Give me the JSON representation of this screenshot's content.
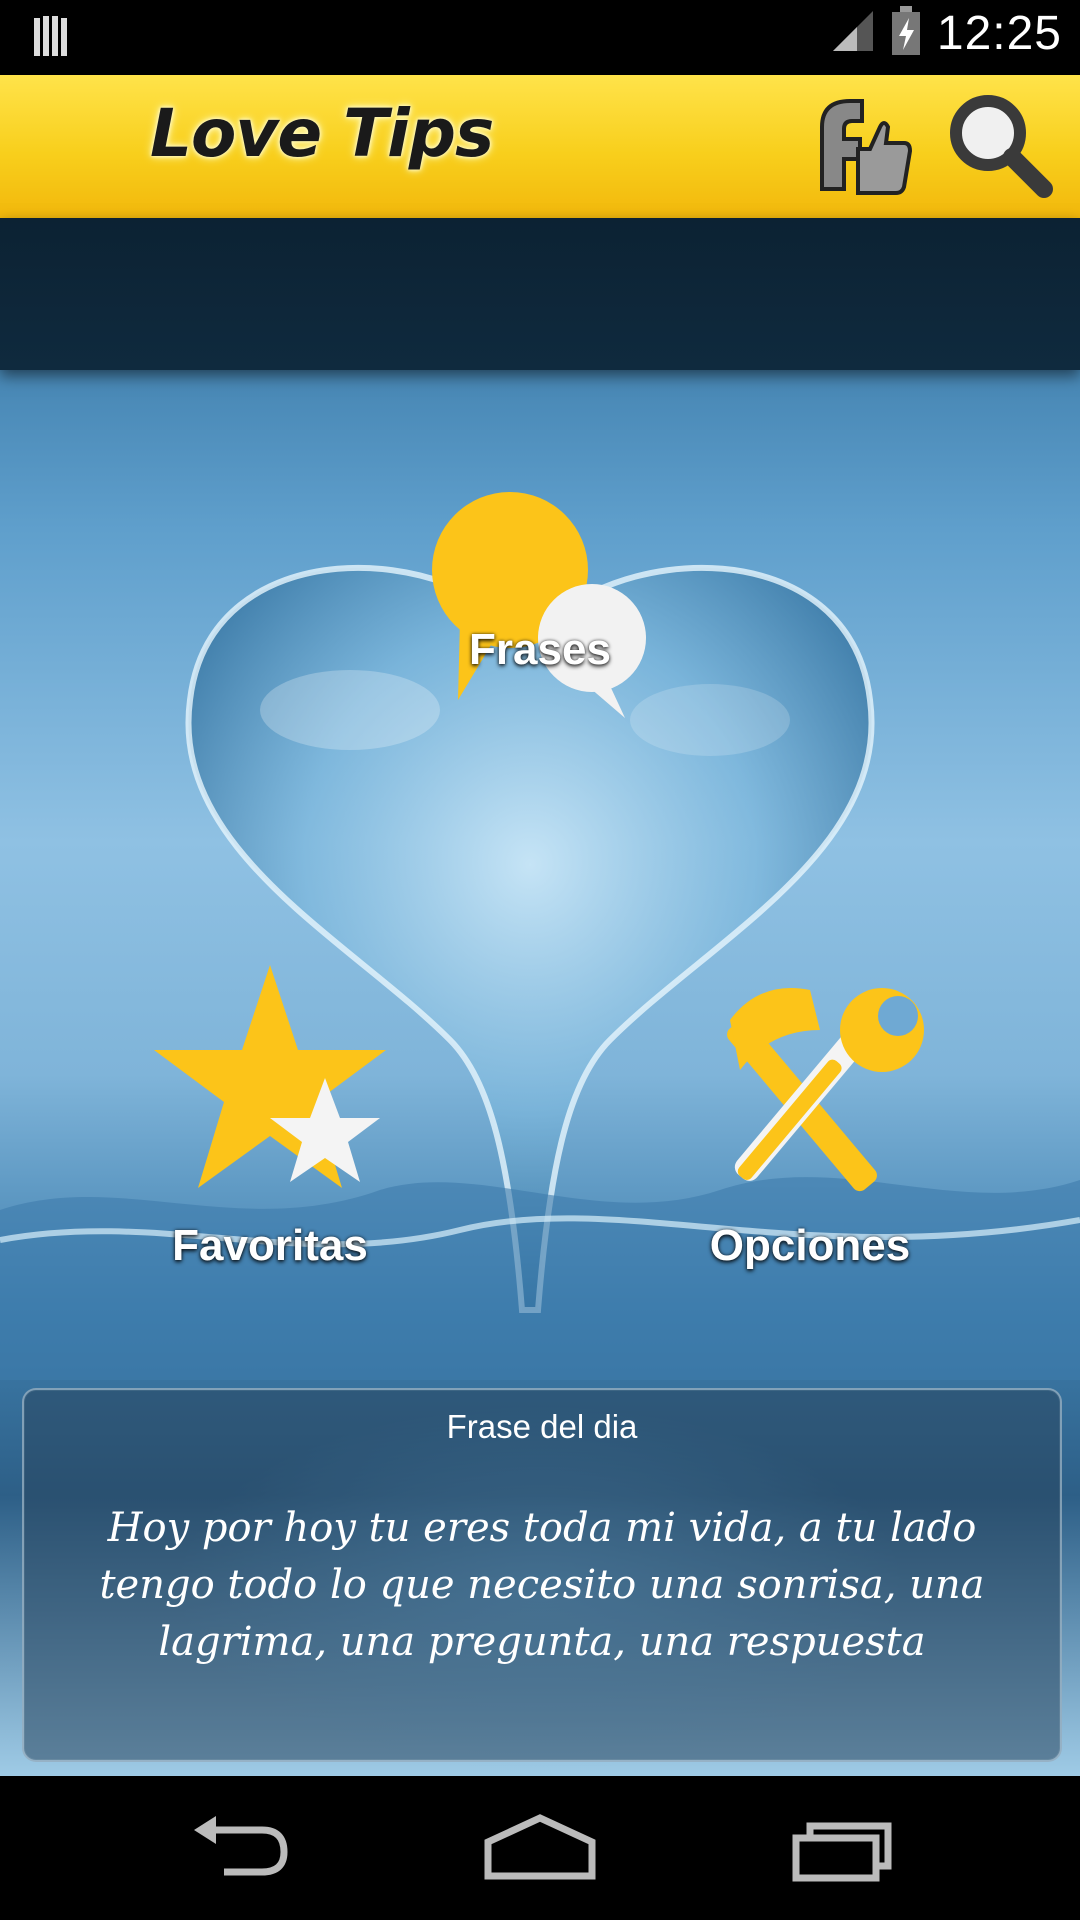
{
  "status_bar": {
    "time": "12:25",
    "icons": [
      "notification-icon",
      "signal-icon",
      "battery-charging-icon"
    ]
  },
  "header": {
    "logo_text": "Love Tips",
    "buttons": [
      "facebook-like-icon",
      "search-icon"
    ]
  },
  "menu": {
    "frases": {
      "label": "Frases",
      "icon": "speech-bubbles-icon"
    },
    "favoritas": {
      "label": "Favoritas",
      "icon": "stars-icon"
    },
    "opciones": {
      "label": "Opciones",
      "icon": "tools-icon"
    }
  },
  "daily_quote": {
    "title": "Frase del dia",
    "text": "Hoy por hoy tu eres toda mi vida, a tu lado tengo todo lo que necesito una sonrisa, una lagrima, una pregunta, una respuesta"
  },
  "nav": [
    "back-icon",
    "home-icon",
    "recents-icon"
  ],
  "colors": {
    "header_yellow": "#f8cf1c",
    "icon_yellow": "#fcc419",
    "background_blue": "#6fa9d3"
  }
}
